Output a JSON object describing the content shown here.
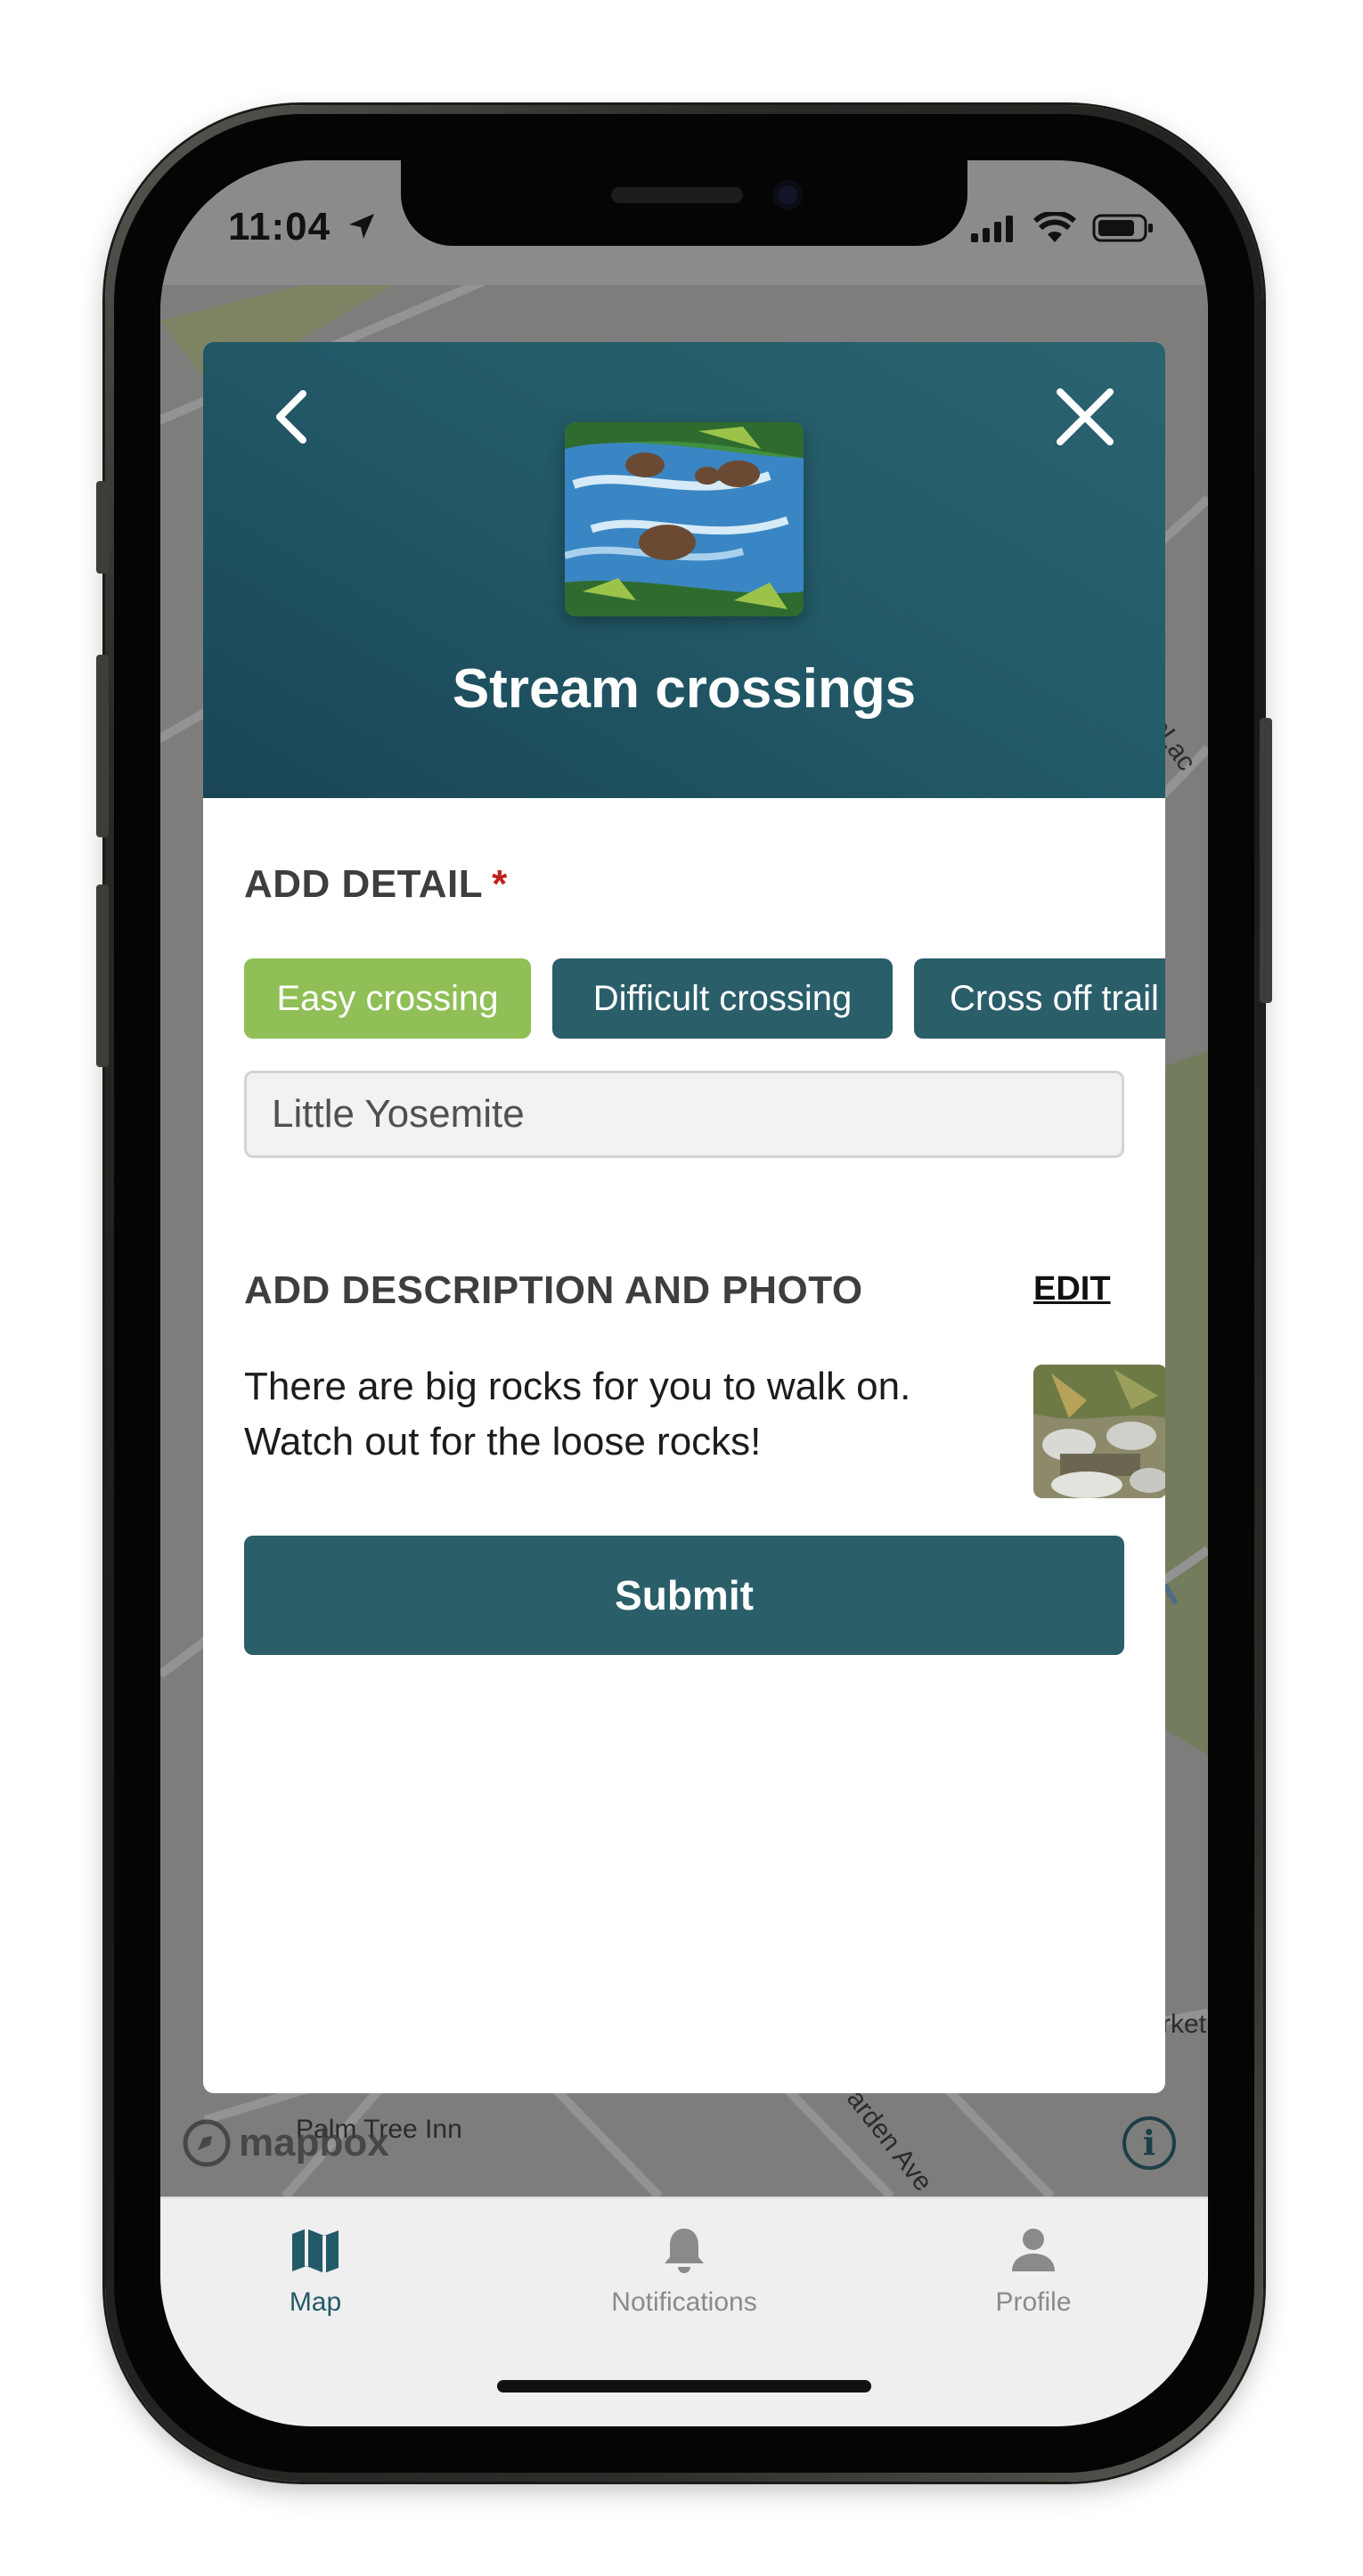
{
  "status_bar": {
    "time": "11:04"
  },
  "map": {
    "labels": {
      "street_top": "McLac",
      "market": "rket",
      "inn": "Palm Tree Inn",
      "avenue": "arden Ave"
    },
    "attribution": "mapbox",
    "info_icon": "info-icon",
    "colors": {
      "road": "#9a9a9a",
      "park": "#6f7b5c",
      "water": "#4c6b87"
    }
  },
  "modal": {
    "title": "Stream crossings",
    "back_icon": "chevron-left-icon",
    "close_icon": "close-icon",
    "detail_label": "ADD DETAIL",
    "required_mark": "*",
    "chips": [
      {
        "label": "Easy crossing",
        "selected": true
      },
      {
        "label": "Difficult crossing",
        "selected": false
      },
      {
        "label": "Cross off trail",
        "selected": false
      }
    ],
    "location_value": "Little Yosemite",
    "description_label": "ADD DESCRIPTION AND PHOTO",
    "edit_label": "EDIT",
    "description_line1": "There are big rocks for you to walk on.",
    "description_line2": "Watch out for the loose rocks!",
    "submit_label": "Submit",
    "colors": {
      "header": "#235a68",
      "chip_selected": "#8fbf56",
      "chip_normal": "#2a5e69",
      "submit": "#2a5e69",
      "required": "#c0211f"
    }
  },
  "tab_bar": {
    "tabs": [
      {
        "label": "Map",
        "icon": "map-icon",
        "active": true
      },
      {
        "label": "Notifications",
        "icon": "bell-icon",
        "active": false
      },
      {
        "label": "Profile",
        "icon": "person-icon",
        "active": false
      }
    ],
    "colors": {
      "active": "#235a68",
      "inactive": "#8a8a8a"
    }
  }
}
